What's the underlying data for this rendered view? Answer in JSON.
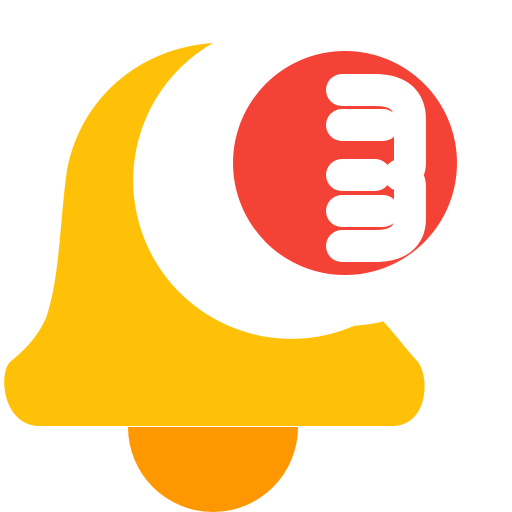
{
  "icon": {
    "name": "notification-bell-icon",
    "badge_count": 3
  },
  "colors": {
    "bell_body": "#FFC107",
    "bell_clapper": "#FF9800",
    "badge_fill": "#F44336",
    "badge_glyph": "#FFFFFF",
    "badge_ring": "#FFFFFF"
  }
}
